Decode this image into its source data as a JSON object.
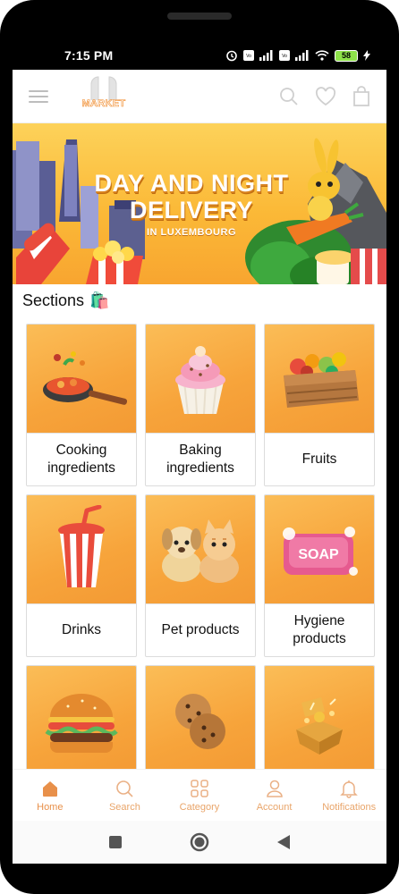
{
  "status_bar": {
    "time": "7:15 PM",
    "battery_level": "58",
    "icons": [
      "alarm-icon",
      "volte-icon",
      "signal-icon",
      "volte-icon",
      "signal-icon",
      "wifi-icon",
      "battery-icon",
      "charging-icon"
    ]
  },
  "header": {
    "logo_text": "MARKET",
    "icons": [
      "menu-icon",
      "search-icon",
      "heart-icon",
      "bag-icon"
    ]
  },
  "banner": {
    "title": "DAY AND NIGHT DELIVERY",
    "subtitle": "IN LUXEMBOURG"
  },
  "sections": {
    "title": "Sections",
    "title_emoji": "🛍️",
    "items": [
      {
        "label": "Cooking ingredients",
        "icon": "frying-pan-icon"
      },
      {
        "label": "Baking ingredients",
        "icon": "cupcake-icon"
      },
      {
        "label": "Fruits",
        "icon": "fruit-crate-icon"
      },
      {
        "label": "Drinks",
        "icon": "soda-cup-icon"
      },
      {
        "label": "Pet products",
        "icon": "dog-and-cat-icon"
      },
      {
        "label": "Hygiene products",
        "icon": "soap-icon"
      },
      {
        "label": "",
        "icon": "burger-icon"
      },
      {
        "label": "",
        "icon": "cookies-icon"
      },
      {
        "label": "",
        "icon": "gift-box-icon"
      }
    ]
  },
  "bottom_nav": {
    "items": [
      {
        "label": "Home",
        "icon": "home-icon",
        "active": true
      },
      {
        "label": "Search",
        "icon": "search-icon",
        "active": false
      },
      {
        "label": "Category",
        "icon": "grid-icon",
        "active": false
      },
      {
        "label": "Account",
        "icon": "user-icon",
        "active": false
      },
      {
        "label": "Notifications",
        "icon": "bell-icon",
        "active": false
      }
    ]
  },
  "colors": {
    "accent": "#e8904a",
    "card_background": "#f7a43b",
    "banner_background": "#fbb937"
  }
}
